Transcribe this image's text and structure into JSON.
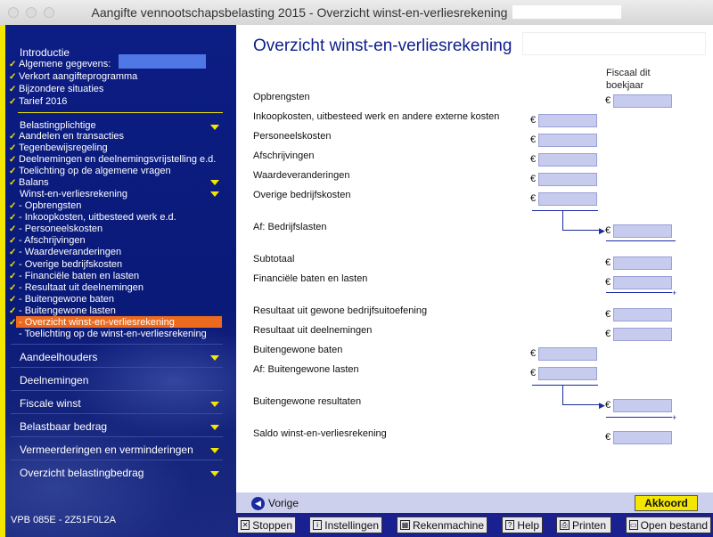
{
  "window": {
    "title": "Aangifte vennootschapsbelasting 2015 - Overzicht winst-en-verliesrekening"
  },
  "sidebar": {
    "intro": "Introductie",
    "group1": [
      {
        "label": "Algemene gegevens:",
        "checked": true
      },
      {
        "label": "Verkort aangifteprogramma",
        "checked": true
      },
      {
        "label": "Bijzondere situaties",
        "checked": true
      },
      {
        "label": "Tarief 2016",
        "checked": true
      }
    ],
    "belastingplichtige": "Belastingplichtige",
    "group2": [
      {
        "label": "Aandelen en transacties",
        "checked": true
      },
      {
        "label": "Tegenbewijsregeling",
        "checked": true
      },
      {
        "label": "Deelnemingen en deelnemingsvrijstelling e.d.",
        "checked": true
      },
      {
        "label": "Toelichting op de algemene vragen",
        "checked": true
      },
      {
        "label": "Balans",
        "checked": true
      }
    ],
    "wvr": "Winst-en-verliesrekening",
    "group3": [
      {
        "label": "- Opbrengsten",
        "checked": true
      },
      {
        "label": "- Inkoopkosten, uitbesteed werk e.d.",
        "checked": true
      },
      {
        "label": "- Personeelskosten",
        "checked": true
      },
      {
        "label": "- Afschrijvingen",
        "checked": true
      },
      {
        "label": "- Waardeveranderingen",
        "checked": true
      },
      {
        "label": "- Overige bedrijfskosten",
        "checked": true
      },
      {
        "label": "- Financiële baten en lasten",
        "checked": true
      },
      {
        "label": "- Resultaat uit deelnemingen",
        "checked": true
      },
      {
        "label": "- Buitengewone baten",
        "checked": true
      },
      {
        "label": "- Buitengewone lasten",
        "checked": true
      },
      {
        "label": "- Overzicht winst-en-verliesrekening",
        "checked": true,
        "active": true
      },
      {
        "label": "- Toelichting op de winst-en-verliesrekening",
        "checked": false
      }
    ],
    "sections": [
      {
        "label": "Aandeelhouders",
        "arrow": true
      },
      {
        "label": "Deelnemingen",
        "arrow": false
      },
      {
        "label": "Fiscale winst",
        "arrow": true
      },
      {
        "label": "Belastbaar bedrag",
        "arrow": true
      },
      {
        "label": "Vermeerderingen en verminderingen",
        "arrow": true
      },
      {
        "label": "Overzicht belastingbedrag",
        "arrow": true
      }
    ],
    "code": "VPB 085E - 2Z51F0L2A"
  },
  "main": {
    "title": "Overzicht winst-en-verliesrekening",
    "column_header_1": "Fiscaal dit",
    "column_header_2": "boekjaar",
    "rows": {
      "opbrengsten": "Opbrengsten",
      "inkoop": "Inkoopkosten, uitbesteed werk en andere externe kosten",
      "personeel": "Personeelskosten",
      "afschrijvingen": "Afschrijvingen",
      "waarde": "Waardeveranderingen",
      "overige": "Overige bedrijfskosten",
      "bedrijfslasten": "Af: Bedrijfslasten",
      "subtotaal": "Subtotaal",
      "financieel": "Financiële baten en lasten",
      "gewone": "Resultaat uit gewone bedrijfsuitoefening",
      "deelnemingen": "Resultaat uit deelnemingen",
      "bg_baten": "Buitengewone baten",
      "bg_lasten": "Af: Buitengewone lasten",
      "bg_resultaten": "Buitengewone resultaten",
      "saldo": "Saldo winst-en-verliesrekening"
    },
    "currency": "€",
    "plus": "+"
  },
  "footer": {
    "vorige": "Vorige",
    "akkoord": "Akkoord",
    "toolbar": {
      "stoppen": "Stoppen",
      "instellingen": "Instellingen",
      "rekenmachine": "Rekenmachine",
      "help": "Help",
      "printen": "Printen",
      "open": "Open bestand"
    }
  }
}
